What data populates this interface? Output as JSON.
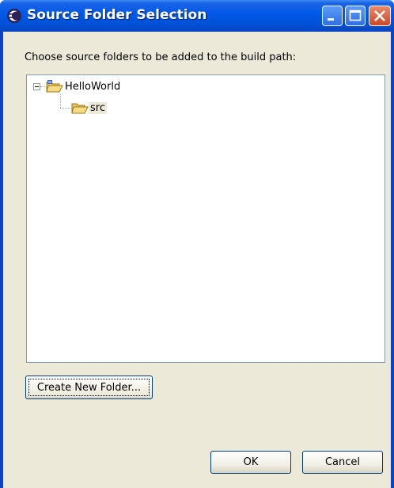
{
  "window": {
    "title": "Source Folder Selection",
    "icon": "eclipse-icon"
  },
  "titlebar_buttons": {
    "minimize": "minimize-icon",
    "maximize": "maximize-icon",
    "close": "close-icon"
  },
  "instruction": "Choose source folders to be added to the build path:",
  "tree": {
    "nodes": [
      {
        "label": "HelloWorld",
        "icon": "project-folder-icon",
        "expanded": true
      },
      {
        "label": "src",
        "icon": "source-folder-icon",
        "selected": true
      }
    ]
  },
  "buttons": {
    "create_new_folder": "Create New Folder...",
    "ok": "OK",
    "cancel": "Cancel"
  },
  "colors": {
    "titlebar": "#0058e6",
    "dialog_background": "#ece9d8",
    "tree_border": "#7f9db9"
  }
}
